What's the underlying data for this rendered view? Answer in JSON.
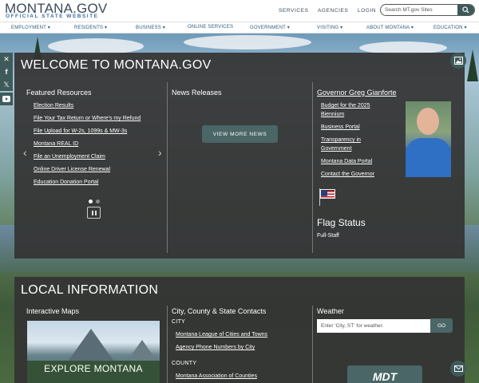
{
  "header": {
    "logo_title": "MONTANA.GOV",
    "logo_sub": "OFFICIAL STATE WEBSITE",
    "links": [
      "SERVICES",
      "AGENCIES",
      "LOGIN"
    ],
    "search_placeholder": "Search MT.gov Sites",
    "search_icon": "search-icon"
  },
  "nav": [
    "EMPLOYMENT ▾",
    "RESIDENTS ▾",
    "BUSINESS ▾",
    "ONLINE SERVICES",
    "GOVERNMENT ▾",
    "VISITING ▾",
    "ABOUT MONTANA ▾",
    "EDUCATION ▾"
  ],
  "social_icons": [
    "close-icon",
    "facebook-icon",
    "x-icon",
    "youtube-icon"
  ],
  "welcome": {
    "title": "WELCOME TO MONTANA.GOV",
    "featured": {
      "heading": "Featured Resources",
      "items": [
        "Election Results",
        "File Your Tax Return or Where's my Refund",
        "File Upload for W-2s, 1099s & MW-3s",
        "Montana REAL ID",
        "File an Unemployment Claim",
        "Online Driver License Renewal",
        "Education Donation Portal"
      ],
      "prev_icon": "chevron-left-icon",
      "next_icon": "chevron-right-icon",
      "pause_icon": "pause-icon"
    },
    "news": {
      "heading": "News Releases",
      "button": "VIEW MORE NEWS"
    },
    "governor": {
      "heading": "Governor Greg Gianforte",
      "items": [
        "Budget for the 2025",
        "Biennium",
        "Business Portal",
        "Transparency in",
        "Government",
        "Montana Data Portal",
        "Contact the Governor"
      ]
    },
    "flag": {
      "heading": "Flag Status",
      "status": "Full-Staff"
    }
  },
  "local": {
    "title": "LOCAL INFORMATION",
    "maps": {
      "heading": "Interactive Maps",
      "label": "EXPLORE MONTANA"
    },
    "contacts": {
      "heading": "City, County & State Contacts",
      "city_label": "CITY",
      "city_items": [
        "Montana League of Cities and Towns",
        "Agency Phone Numbers by City"
      ],
      "county_label": "COUNTY",
      "county_items": [
        "Montana Association of Counties"
      ]
    },
    "weather": {
      "heading": "Weather",
      "placeholder": "Enter 'City, ST' for weather.",
      "button": "GO",
      "badge": "MDT"
    }
  },
  "colors": {
    "accent": "#4a6666",
    "panel": "#343434",
    "nav_text": "#2e5d7d"
  }
}
